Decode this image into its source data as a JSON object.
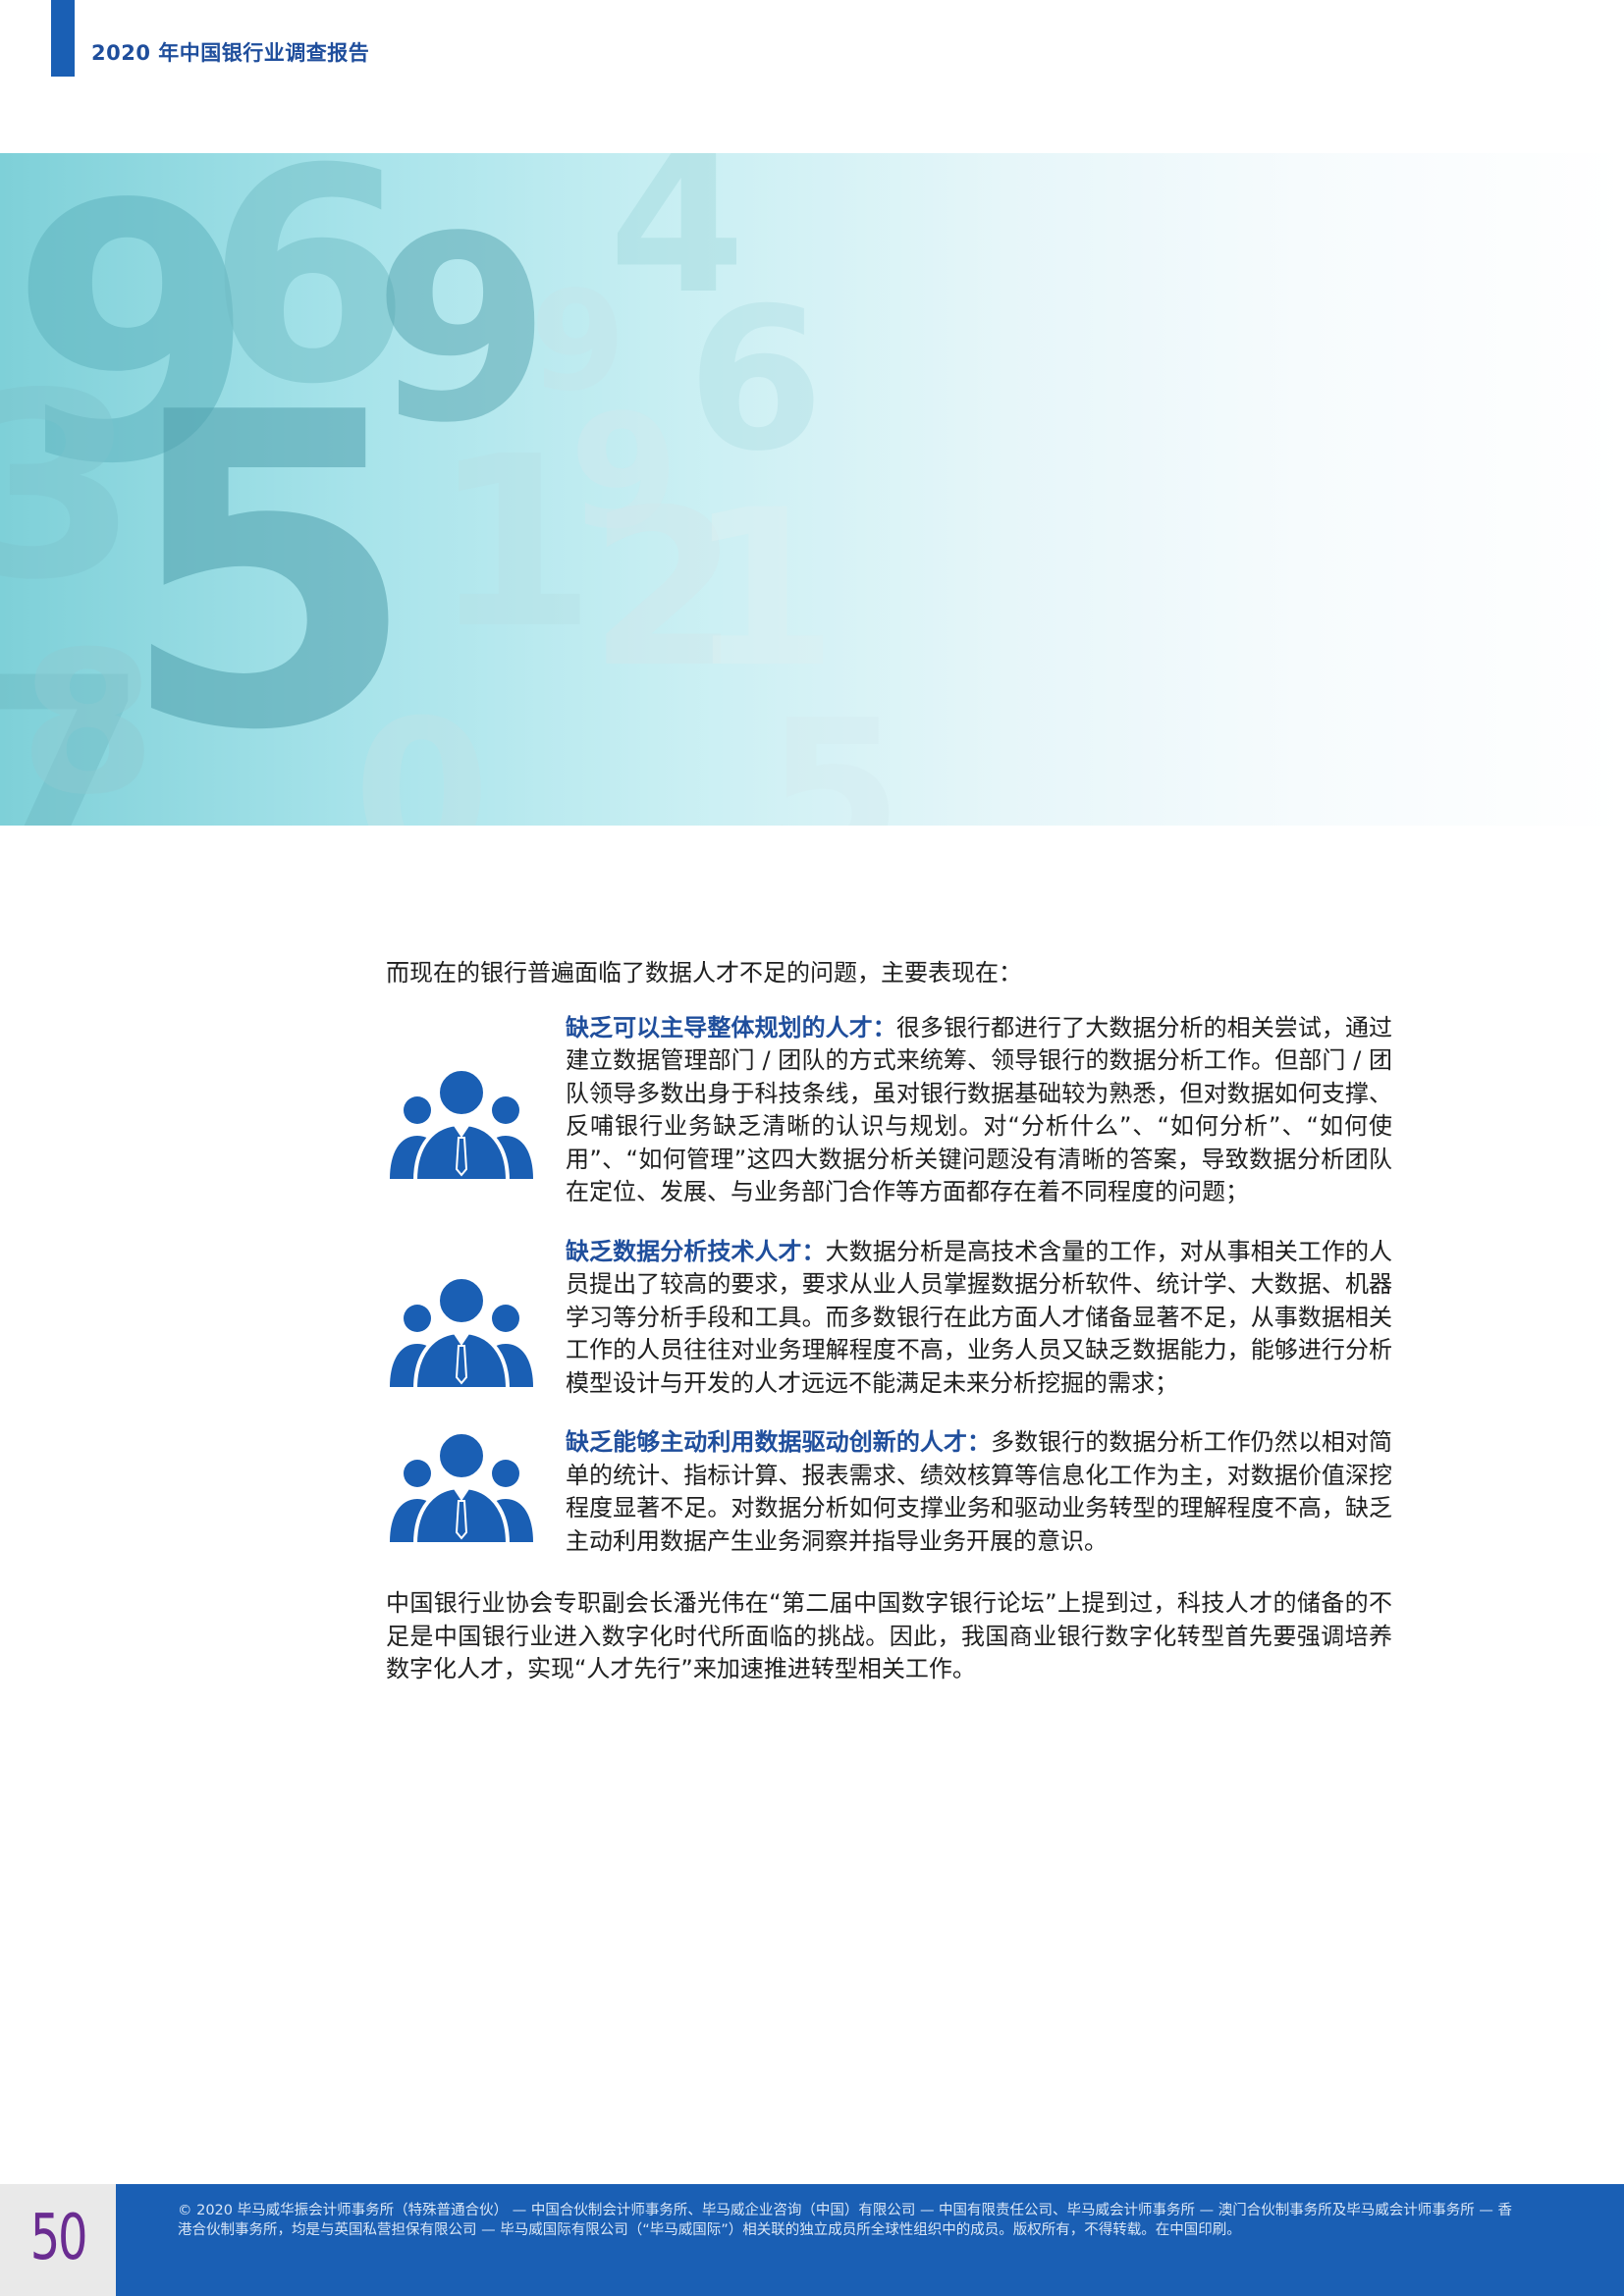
{
  "header": {
    "title": "2020 年中国银行业调查报告"
  },
  "banner": {
    "decorative_numerals": [
      "9",
      "6",
      "4",
      "9",
      "6",
      "5",
      "3",
      "1",
      "7",
      "8",
      "2",
      "5",
      "0",
      "9",
      "1",
      "9"
    ]
  },
  "content": {
    "intro": "而现在的银行普遍面临了数据人才不足的问题，主要表现在：",
    "items": [
      {
        "icon": "people-group-icon",
        "heading": "缺乏可以主导整体规划的人才：",
        "text": "很多银行都进行了大数据分析的相关尝试，通过建立数据管理部门 / 团队的方式来统筹、领导银行的数据分析工作。但部门 / 团队领导多数出身于科技条线，虽对银行数据基础较为熟悉，但对数据如何支撑、反哺银行业务缺乏清晰的认识与规划。对“分析什么”、“如何分析”、“如何使用”、“如何管理”这四大数据分析关键问题没有清晰的答案，导致数据分析团队在定位、发展、与业务部门合作等方面都存在着不同程度的问题；"
      },
      {
        "icon": "people-group-icon",
        "heading": "缺乏数据分析技术人才：",
        "text": "大数据分析是高技术含量的工作，对从事相关工作的人员提出了较高的要求，要求从业人员掌握数据分析软件、统计学、大数据、机器学习等分析手段和工具。而多数银行在此方面人才储备显著不足，从事数据相关工作的人员往往对业务理解程度不高，业务人员又缺乏数据能力，能够进行分析模型设计与开发的人才远远不能满足未来分析挖掘的需求；"
      },
      {
        "icon": "people-group-icon",
        "heading": "缺乏能够主动利用数据驱动创新的人才：",
        "text": "多数银行的数据分析工作仍然以相对简单的统计、指标计算、报表需求、绩效核算等信息化工作为主，对数据价值深挖程度显著不足。对数据分析如何支撑业务和驱动业务转型的理解程度不高，缺乏主动利用数据产生业务洞察并指导业务开展的意识。"
      }
    ],
    "outro": "中国银行业协会专职副会长潘光伟在“第二届中国数字银行论坛”上提到过，科技人才的储备的不足是中国银行业进入数字化时代所面临的挑战。因此，我国商业银行数字化转型首先要强调培养数字化人才，实现“人才先行”来加速推进转型相关工作。"
  },
  "footer": {
    "page_number": "50",
    "legal": "© 2020 毕马威华振会计师事务所（特殊普通合伙） — 中国合伙制会计师事务所、毕马威企业咨询（中国）有限公司 — 中国有限责任公司、毕马威会计师事务所 — 澳门合伙制事务所及毕马威会计师事务所 — 香港合伙制事务所，均是与英国私营担保有限公司 — 毕马威国际有限公司（“毕马威国际”）相关联的独立成员所全球性组织中的成员。版权所有，不得转载。在中国印刷。"
  },
  "colors": {
    "brand_blue": "#1a5fb4",
    "heading_blue": "#1f4e9c",
    "page_number_purple": "#6a2c91",
    "banner_teal": "#7ed0d8"
  }
}
